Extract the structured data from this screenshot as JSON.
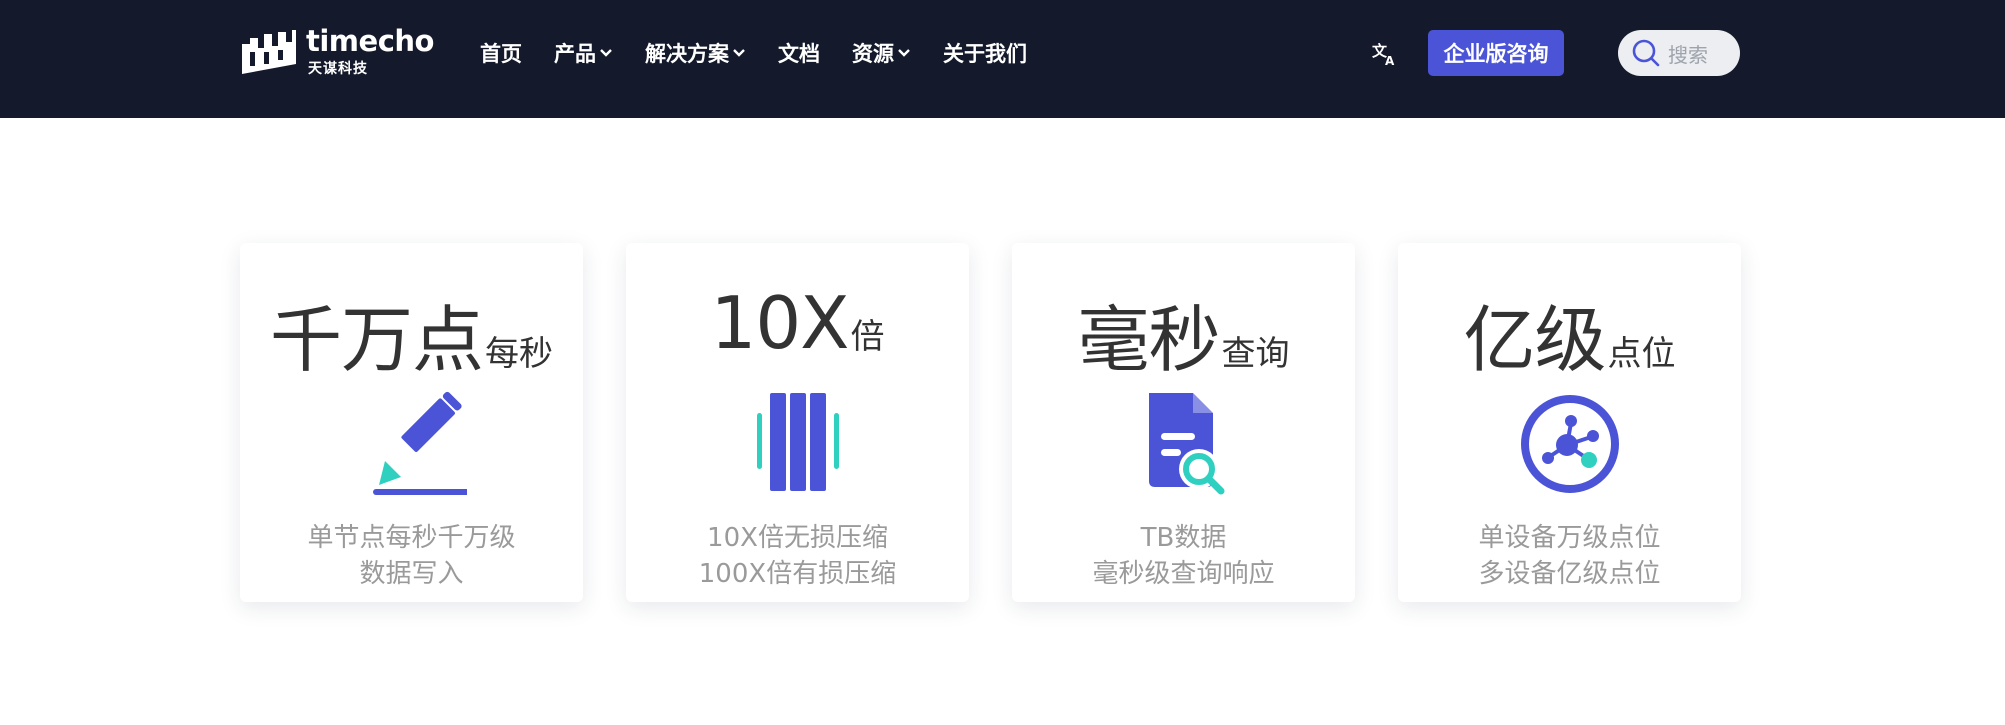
{
  "header": {
    "logo": {
      "word": "timecho",
      "subtitle": "天谋科技"
    },
    "nav": [
      {
        "label": "首页",
        "has_dropdown": false
      },
      {
        "label": "产品",
        "has_dropdown": true
      },
      {
        "label": "解决方案",
        "has_dropdown": true
      },
      {
        "label": "文档",
        "has_dropdown": false
      },
      {
        "label": "资源",
        "has_dropdown": true
      },
      {
        "label": "关于我们",
        "has_dropdown": false
      }
    ],
    "language_icon": "translate-icon",
    "consult_button": "企业版咨询",
    "search": {
      "placeholder": "搜索",
      "icon": "search-icon"
    }
  },
  "colors": {
    "header_bg": "#141a2b",
    "accent": "#4b54d6",
    "teal": "#2fd0c0"
  },
  "cards": [
    {
      "big": "千万点",
      "small": "每秒",
      "icon": "pencil-write-icon",
      "desc": [
        "单节点每秒千万级",
        "数据写入"
      ]
    },
    {
      "big": "10X",
      "small": "倍",
      "icon": "compression-bars-icon",
      "desc": [
        "10X倍无损压缩",
        "100X倍有损压缩"
      ]
    },
    {
      "big": "毫秒",
      "small": "查询",
      "icon": "document-search-icon",
      "desc": [
        "TB数据",
        "毫秒级查询响应"
      ]
    },
    {
      "big": "亿级",
      "small": "点位",
      "icon": "network-nodes-icon",
      "desc": [
        "单设备万级点位",
        "多设备亿级点位"
      ]
    }
  ]
}
